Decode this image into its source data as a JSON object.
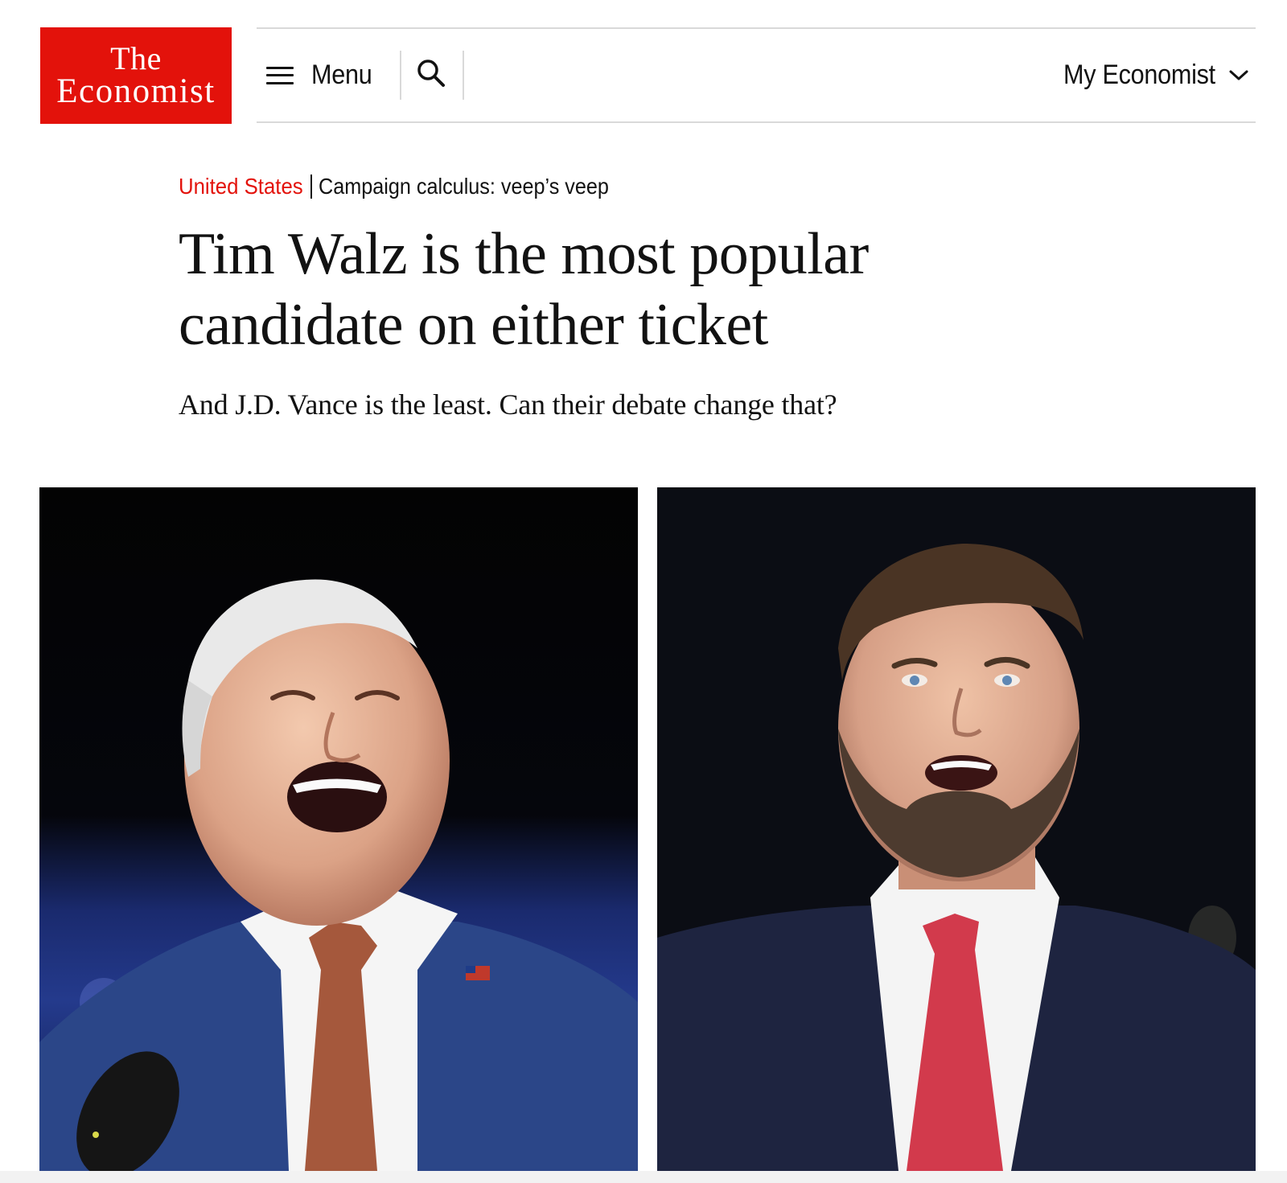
{
  "header": {
    "logo": {
      "line1": "The",
      "line2": "Economist"
    },
    "menu_label": "Menu",
    "search_icon": "search-icon",
    "my_economist_label": "My Economist",
    "chevron_icon": "chevron-down-icon"
  },
  "article": {
    "section": "United States",
    "topic": "Campaign calculus: veep’s veep",
    "headline": "Tim Walz is the most popular candidate on either ticket",
    "standfirst": "And J.D. Vance is the least. Can their debate change that?"
  },
  "colors": {
    "brand_red": "#e3120b",
    "text": "#121212",
    "rule": "#d9d9d9"
  }
}
